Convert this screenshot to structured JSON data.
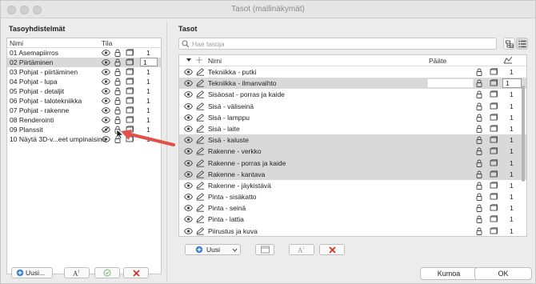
{
  "window": {
    "title": "Tasot (mallinäkymät)"
  },
  "left": {
    "title": "Tasoyhdistelmät",
    "columns": {
      "name": "Nimi",
      "state": "Tila"
    },
    "rows": [
      {
        "name": "01 Asemapiirros",
        "num": "1",
        "selected": false,
        "edit": false
      },
      {
        "name": "02 Piirtäminen",
        "num": "1",
        "selected": true,
        "edit": true
      },
      {
        "name": "03 Pohjat - piirtäminen",
        "num": "1",
        "selected": false,
        "edit": false
      },
      {
        "name": "04 Pohjat - lupa",
        "num": "1",
        "selected": false,
        "edit": false
      },
      {
        "name": "05 Pohjat - detaljit",
        "num": "1",
        "selected": false,
        "edit": false
      },
      {
        "name": "06 Pohjat - talotekniikka",
        "num": "1",
        "selected": false,
        "edit": false
      },
      {
        "name": "07 Pohjat - rakenne",
        "num": "1",
        "selected": false,
        "edit": false
      },
      {
        "name": "08 Renderointi",
        "num": "1",
        "selected": false,
        "edit": false
      },
      {
        "name": "09 Planssit",
        "num": "1",
        "selected": false,
        "edit": false
      },
      {
        "name": "10 Näytä 3D-v...eet umpinaisina",
        "num": "1",
        "selected": false,
        "edit": false
      }
    ],
    "buttons": {
      "new": "Uusi..."
    }
  },
  "right": {
    "title": "Tasot",
    "search_placeholder": "Hae tasoja",
    "columns": {
      "name": "Nimi",
      "suffix": "Pääte"
    },
    "rows": [
      {
        "name": "Tekniikka - putki",
        "num": "1",
        "selected": false,
        "edit": false
      },
      {
        "name": "Tekniikka - ilmanvaihto",
        "num": "1",
        "selected": true,
        "edit": true
      },
      {
        "name": "Sisäosat - porras ja kaide",
        "num": "1",
        "selected": false,
        "edit": false
      },
      {
        "name": "Sisä - väliseinä",
        "num": "1",
        "selected": false,
        "edit": false
      },
      {
        "name": "Sisä - lamppu",
        "num": "1",
        "selected": false,
        "edit": false
      },
      {
        "name": "Sisä - laite",
        "num": "1",
        "selected": false,
        "edit": false
      },
      {
        "name": "Sisä - kaluste",
        "num": "1",
        "selected": true,
        "edit": false
      },
      {
        "name": "Rakenne - verkko",
        "num": "1",
        "selected": true,
        "edit": false
      },
      {
        "name": "Rakenne - porras ja kaide",
        "num": "1",
        "selected": true,
        "edit": false
      },
      {
        "name": "Rakenne - kantava",
        "num": "1",
        "selected": true,
        "edit": false
      },
      {
        "name": "Rakenne - jäykistävä",
        "num": "1",
        "selected": false,
        "edit": false
      },
      {
        "name": "Pinta - sisäkatto",
        "num": "1",
        "selected": false,
        "edit": false
      },
      {
        "name": "Pinta - seinä",
        "num": "1",
        "selected": false,
        "edit": false
      },
      {
        "name": "Pinta - lattia",
        "num": "1",
        "selected": false,
        "edit": false
      },
      {
        "name": "Piirustus ja kuva",
        "num": "1",
        "selected": false,
        "edit": false
      }
    ],
    "buttons": {
      "new": "Uusi"
    }
  },
  "footer": {
    "cancel": "Kumoa",
    "ok": "OK"
  },
  "colors": {
    "delete": "#d9342b",
    "arrow": "#e2504a",
    "accent": "#3a7bd5"
  }
}
